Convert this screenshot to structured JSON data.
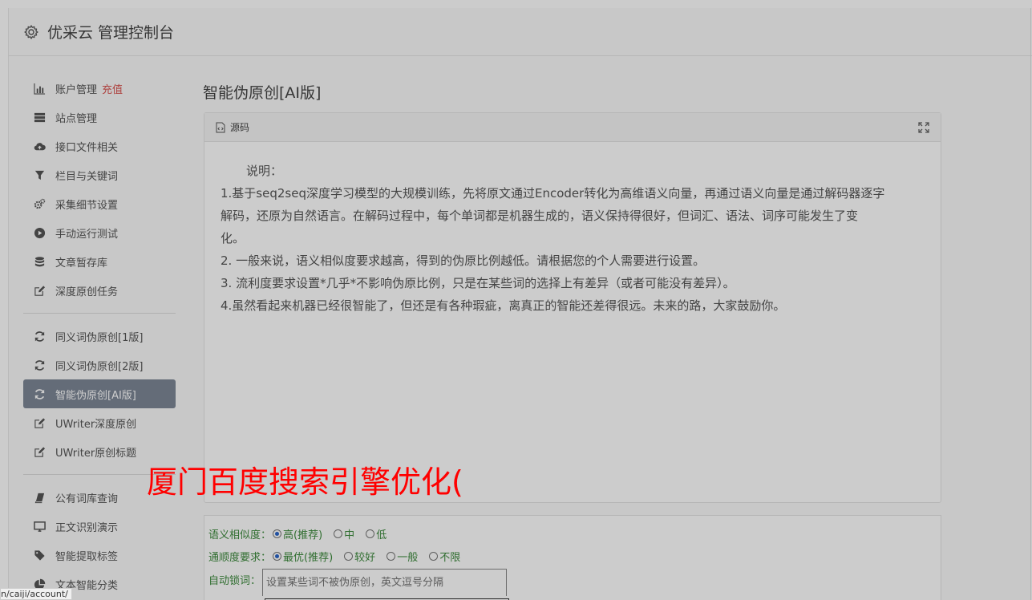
{
  "header": {
    "title": "优采云 管理控制台",
    "icon": "gear-icon"
  },
  "sidebar": {
    "group1": [
      {
        "label": "账户管理",
        "badge": "充值",
        "icon": "bar-chart-icon"
      },
      {
        "label": "站点管理",
        "icon": "server-icon"
      },
      {
        "label": "接口文件相关",
        "icon": "cloud-upload-icon"
      },
      {
        "label": "栏目与关键词",
        "icon": "filter-icon"
      },
      {
        "label": "采集细节设置",
        "icon": "cogs-icon"
      },
      {
        "label": "手动运行测试",
        "icon": "play-circle-icon"
      },
      {
        "label": "文章暂存库",
        "icon": "database-icon"
      },
      {
        "label": "深度原创任务",
        "icon": "edit-icon"
      }
    ],
    "group2": [
      {
        "label": "同义词伪原创[1版]",
        "icon": "refresh-icon"
      },
      {
        "label": "同义词伪原创[2版]",
        "icon": "refresh-icon"
      },
      {
        "label": "智能伪原创[AI版]",
        "icon": "refresh-icon",
        "active": true
      },
      {
        "label": "UWriter深度原创",
        "icon": "edit-icon"
      },
      {
        "label": "UWriter原创标题",
        "icon": "edit-icon"
      }
    ],
    "group3": [
      {
        "label": "公有词库查询",
        "icon": "book-icon"
      },
      {
        "label": "正文识别演示",
        "icon": "monitor-icon"
      },
      {
        "label": "智能提取标签",
        "icon": "tag-icon"
      },
      {
        "label": "文本智能分类",
        "icon": "pie-chart-icon"
      }
    ]
  },
  "main": {
    "title": "智能伪原创[AI版]",
    "panel": {
      "head": "源码",
      "lines": [
        "说明：",
        "1.基于seq2seq深度学习模型的大规模训练，先将原文通过Encoder转化为高维语义向量，再通过语义向量是通过解码器逐字",
        "解码，还原为自然语言。在解码过程中，每个单词都是机器生成的，语义保持得很好，但词汇、语法、词序可能发生了变",
        "化。",
        "2. 一般来说，语义相似度要求越高，得到的伪原比例越低。请根据您的个人需要进行设置。",
        "3. 流利度要求设置*几乎*不影响伪原比例，只是在某些词的选择上有差异（或者可能没有差异）。",
        "4.虽然看起来机器已经很智能了，但还是有各种瑕疵，离真正的智能还差得很远。未来的路，大家鼓励你。"
      ]
    },
    "options": {
      "similarity": {
        "label": "语义相似度：",
        "choices": [
          "高(推荐)",
          "中",
          "低"
        ],
        "selected": 0
      },
      "fluency": {
        "label": "通顺度要求：",
        "choices": [
          "最优(推荐)",
          "较好",
          "一般",
          "不限"
        ],
        "selected": 0
      },
      "lock": {
        "label": "自动锁词：",
        "placeholder": "设置某些词不被伪原创，英文逗号分隔"
      }
    }
  },
  "watermark": "厦门百度搜索引擎优化(",
  "status_url": "n/caiji/account/"
}
